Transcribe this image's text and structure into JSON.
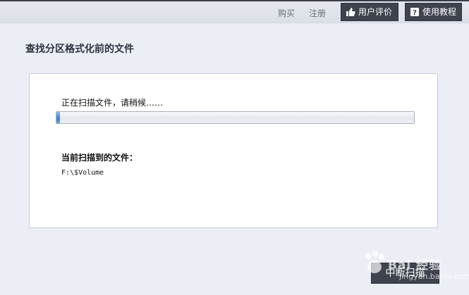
{
  "header": {
    "buy_label": "购买",
    "register_label": "注册",
    "review_label": "用户评价",
    "tutorial_label": "使用教程"
  },
  "page": {
    "title": "查找分区格式化前的文件"
  },
  "scan": {
    "status_text": "正在扫描文件，请稍候……",
    "progress": 0.01,
    "current_file_label": "当前扫描到的文件：",
    "current_file": "F:\\$Volume"
  },
  "actions": {
    "stop_label": "中断扫描"
  },
  "watermark": {
    "text": "Bai  经验",
    "sub": "jingyan.baidu.com"
  },
  "colors": {
    "background": "#ebeef5",
    "dark_button": "#3e434e",
    "progress_fill": "#3c7fd0"
  }
}
